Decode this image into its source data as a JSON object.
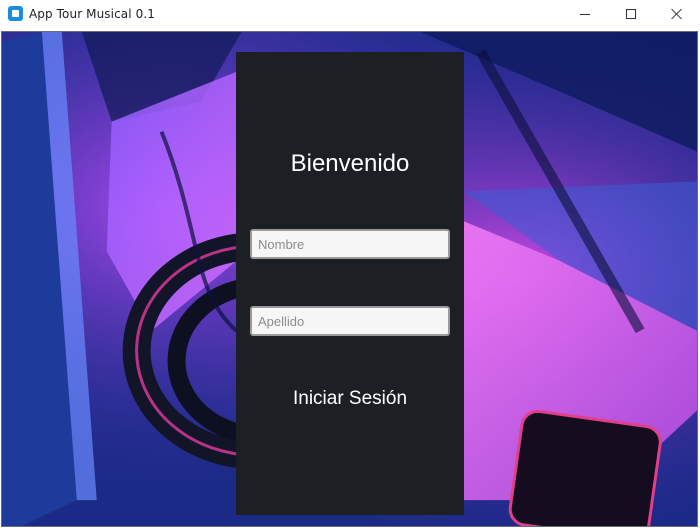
{
  "window": {
    "title": "App Tour Musical 0.1",
    "controls": {
      "minimize_icon": "minimize-icon",
      "maximize_icon": "maximize-icon",
      "close_icon": "close-icon"
    }
  },
  "login": {
    "heading": "Bienvenido",
    "first_name_placeholder": "Nombre",
    "first_name_value": "",
    "last_name_placeholder": "Apellido",
    "last_name_value": "",
    "submit_label": "Iniciar Sesión"
  },
  "colors": {
    "panel": "#1c2025",
    "background_blue": "#1a2a8a",
    "background_magenta": "#d23cff",
    "input_background": "#f7f7f7",
    "text_light": "#ffffff"
  }
}
